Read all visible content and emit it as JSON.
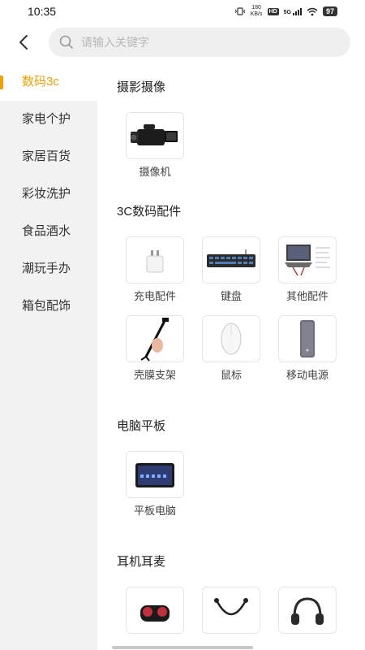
{
  "status_bar": {
    "time": "10:35",
    "net_speed_value": "180",
    "net_speed_unit": "KB/s",
    "hd_badge": "HD",
    "signal_label": "5G",
    "battery": "97"
  },
  "header": {
    "search_placeholder": "请输入关键字"
  },
  "sidebar": {
    "items": [
      {
        "label": "数码3c"
      },
      {
        "label": "家电个护"
      },
      {
        "label": "家居百货"
      },
      {
        "label": "彩妆洗护"
      },
      {
        "label": "食品酒水"
      },
      {
        "label": "潮玩手办"
      },
      {
        "label": "箱包配饰"
      }
    ],
    "active_index": 0
  },
  "colors": {
    "accent": "#f0a000",
    "sidebar_bg": "#f2f2f2",
    "search_bg": "#efefef"
  },
  "sections": [
    {
      "title": "摄影摄像",
      "items": [
        {
          "label": "摄像机",
          "icon": "camcorder-icon"
        }
      ]
    },
    {
      "title": "3C数码配件",
      "items": [
        {
          "label": "充电配件",
          "icon": "charger-icon"
        },
        {
          "label": "键盘",
          "icon": "keyboard-icon"
        },
        {
          "label": "其他配件",
          "icon": "laptop-stand-icon"
        },
        {
          "label": "壳膜支架",
          "icon": "selfie-stick-icon"
        },
        {
          "label": "鼠标",
          "icon": "mouse-icon"
        },
        {
          "label": "移动电源",
          "icon": "power-bank-icon"
        }
      ]
    },
    {
      "title": "电脑平板",
      "items": [
        {
          "label": "平板电脑",
          "icon": "tablet-icon"
        }
      ]
    },
    {
      "title": "耳机耳麦",
      "items": [
        {
          "label": "",
          "icon": "earbuds-icon"
        },
        {
          "label": "",
          "icon": "neckband-earphones-icon"
        },
        {
          "label": "",
          "icon": "headphones-icon"
        }
      ]
    }
  ]
}
